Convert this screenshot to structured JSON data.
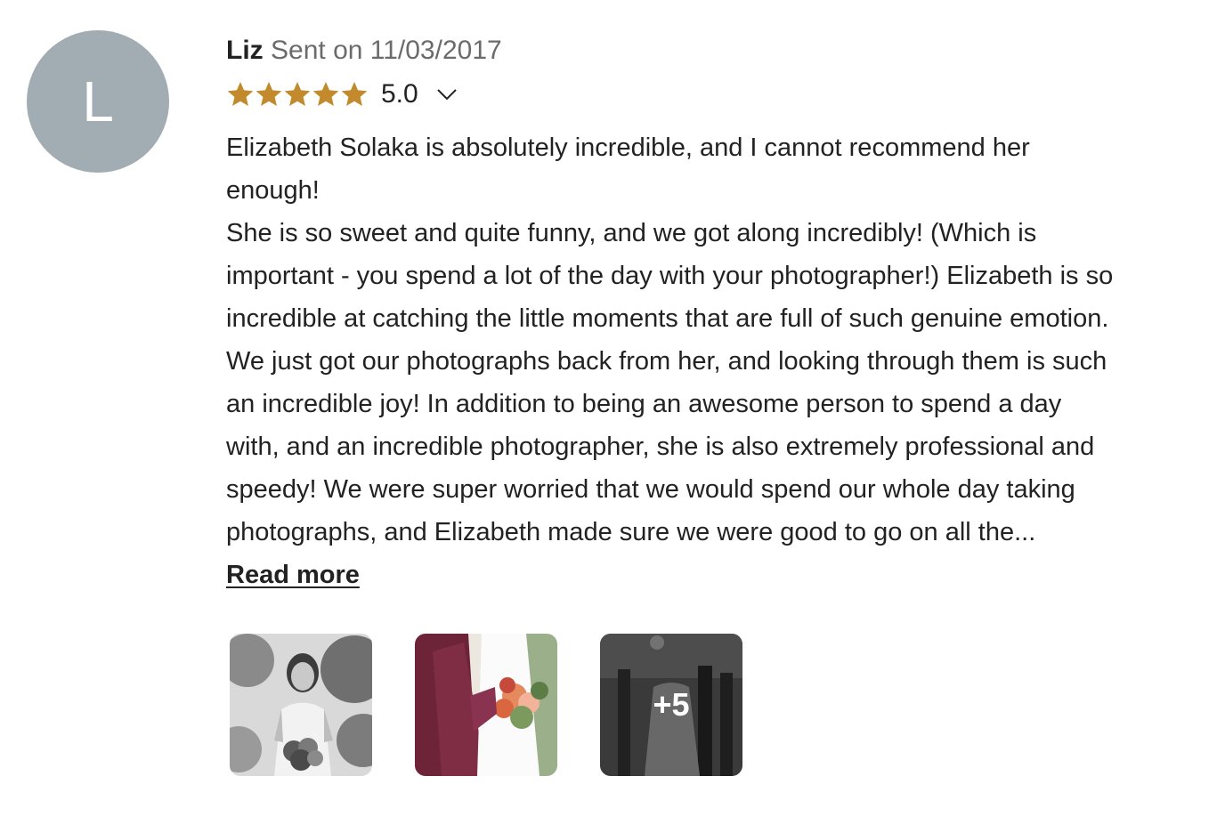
{
  "review": {
    "avatar_letter": "L",
    "reviewer_name": "Liz",
    "sent_text": "Sent on 11/03/2017",
    "rating": "5.0",
    "star_count": 5,
    "star_color": "#c28a2d",
    "avatar_color": "#a1acb3",
    "expand_icon": "chevron-down-icon",
    "lines": [
      "Elizabeth Solaka is absolutely incredible, and I cannot recommend her",
      "enough!",
      "She is so sweet and quite funny, and we got along incredibly! (Which is",
      "important - you spend a lot of the day with your photographer!) Elizabeth is so",
      "incredible at catching the little moments that are full of such genuine emotion.",
      "We just got our photographs back from her, and looking through them is such",
      "an incredible joy! In addition to being an awesome person to spend a day",
      "with, and an incredible photographer, she is also extremely professional and",
      "speedy! We were super worried that we would spend our whole day taking",
      "photographs, and Elizabeth made sure we were good to go on all the..."
    ],
    "read_more_label": "Read more",
    "photos": {
      "more_label": "+5"
    }
  }
}
